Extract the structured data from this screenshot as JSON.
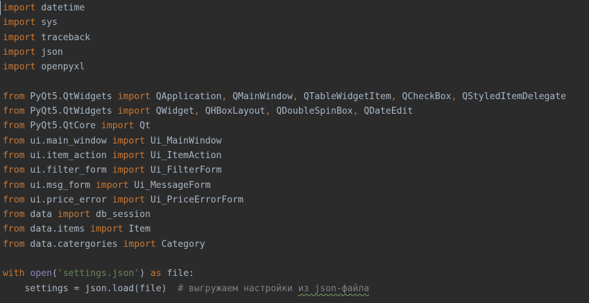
{
  "editor": {
    "lines": [
      {
        "tokens": [
          {
            "t": "import",
            "c": "kw"
          },
          {
            "t": " datetime",
            "c": "id"
          }
        ]
      },
      {
        "tokens": [
          {
            "t": "import",
            "c": "kw"
          },
          {
            "t": " sys",
            "c": "id"
          }
        ]
      },
      {
        "tokens": [
          {
            "t": "import",
            "c": "kw"
          },
          {
            "t": " traceback",
            "c": "id"
          }
        ]
      },
      {
        "tokens": [
          {
            "t": "import",
            "c": "kw"
          },
          {
            "t": " json",
            "c": "id"
          }
        ]
      },
      {
        "tokens": [
          {
            "t": "import",
            "c": "kw"
          },
          {
            "t": " openpyxl",
            "c": "id"
          }
        ]
      },
      {
        "tokens": []
      },
      {
        "tokens": [
          {
            "t": "from",
            "c": "kw"
          },
          {
            "t": " PyQt5.QtWidgets ",
            "c": "id"
          },
          {
            "t": "import",
            "c": "kw"
          },
          {
            "t": " QApplication",
            "c": "id"
          },
          {
            "t": ",",
            "c": "kw"
          },
          {
            "t": " QMainWindow",
            "c": "id"
          },
          {
            "t": ",",
            "c": "kw"
          },
          {
            "t": " QTableWidgetItem",
            "c": "id"
          },
          {
            "t": ",",
            "c": "kw"
          },
          {
            "t": " QCheckBox",
            "c": "id"
          },
          {
            "t": ",",
            "c": "kw"
          },
          {
            "t": " QStyledItemDelegate",
            "c": "id"
          }
        ]
      },
      {
        "tokens": [
          {
            "t": "from",
            "c": "kw"
          },
          {
            "t": " PyQt5.QtWidgets ",
            "c": "id"
          },
          {
            "t": "import",
            "c": "kw"
          },
          {
            "t": " QWidget",
            "c": "id"
          },
          {
            "t": ",",
            "c": "kw"
          },
          {
            "t": " QHBoxLayout",
            "c": "id"
          },
          {
            "t": ",",
            "c": "kw"
          },
          {
            "t": " QDoubleSpinBox",
            "c": "id"
          },
          {
            "t": ",",
            "c": "kw"
          },
          {
            "t": " QDateEdit",
            "c": "id"
          }
        ]
      },
      {
        "tokens": [
          {
            "t": "from",
            "c": "kw"
          },
          {
            "t": " PyQt5.QtCore ",
            "c": "id"
          },
          {
            "t": "import",
            "c": "kw"
          },
          {
            "t": " Qt",
            "c": "id"
          }
        ]
      },
      {
        "tokens": [
          {
            "t": "from",
            "c": "kw"
          },
          {
            "t": " ui.main_window ",
            "c": "id"
          },
          {
            "t": "import",
            "c": "kw"
          },
          {
            "t": " Ui_MainWindow",
            "c": "id"
          }
        ]
      },
      {
        "tokens": [
          {
            "t": "from",
            "c": "kw"
          },
          {
            "t": " ui.item_action ",
            "c": "id"
          },
          {
            "t": "import",
            "c": "kw"
          },
          {
            "t": " Ui_ItemAction",
            "c": "id"
          }
        ]
      },
      {
        "tokens": [
          {
            "t": "from",
            "c": "kw"
          },
          {
            "t": " ui.filter_form ",
            "c": "id"
          },
          {
            "t": "import",
            "c": "kw"
          },
          {
            "t": " Ui_FilterForm",
            "c": "id"
          }
        ]
      },
      {
        "tokens": [
          {
            "t": "from",
            "c": "kw"
          },
          {
            "t": " ui.msg_form ",
            "c": "id"
          },
          {
            "t": "import",
            "c": "kw"
          },
          {
            "t": " Ui_MessageForm",
            "c": "id"
          }
        ]
      },
      {
        "tokens": [
          {
            "t": "from",
            "c": "kw"
          },
          {
            "t": " ui.price_error ",
            "c": "id"
          },
          {
            "t": "import",
            "c": "kw"
          },
          {
            "t": " Ui_PriceErrorForm",
            "c": "id"
          }
        ]
      },
      {
        "tokens": [
          {
            "t": "from",
            "c": "kw"
          },
          {
            "t": " data ",
            "c": "id"
          },
          {
            "t": "import",
            "c": "kw"
          },
          {
            "t": " db_session",
            "c": "id"
          }
        ]
      },
      {
        "tokens": [
          {
            "t": "from",
            "c": "kw"
          },
          {
            "t": " data.items ",
            "c": "id"
          },
          {
            "t": "import",
            "c": "kw"
          },
          {
            "t": " Item",
            "c": "id"
          }
        ]
      },
      {
        "tokens": [
          {
            "t": "from",
            "c": "kw"
          },
          {
            "t": " data.catergories ",
            "c": "id"
          },
          {
            "t": "import",
            "c": "kw"
          },
          {
            "t": " Category",
            "c": "id"
          }
        ]
      },
      {
        "tokens": []
      },
      {
        "tokens": [
          {
            "t": "with",
            "c": "kw"
          },
          {
            "t": " ",
            "c": "id"
          },
          {
            "t": "open",
            "c": "builtin"
          },
          {
            "t": "(",
            "c": "id"
          },
          {
            "t": "'settings.json'",
            "c": "str"
          },
          {
            "t": ") ",
            "c": "id"
          },
          {
            "t": "as",
            "c": "kw"
          },
          {
            "t": " file:",
            "c": "id"
          }
        ]
      },
      {
        "tokens": [
          {
            "t": "    settings = json.load(file)  ",
            "c": "id"
          },
          {
            "t": "# выгружаем настройки ",
            "c": "cm"
          },
          {
            "t": "из json-файла",
            "c": "cm typo"
          }
        ]
      }
    ]
  },
  "colors": {
    "background": "#2b2b2b",
    "keyword": "#cc7832",
    "identifier": "#a9b7c6",
    "builtin": "#8888c6",
    "string": "#6a8759",
    "comment": "#808080"
  }
}
